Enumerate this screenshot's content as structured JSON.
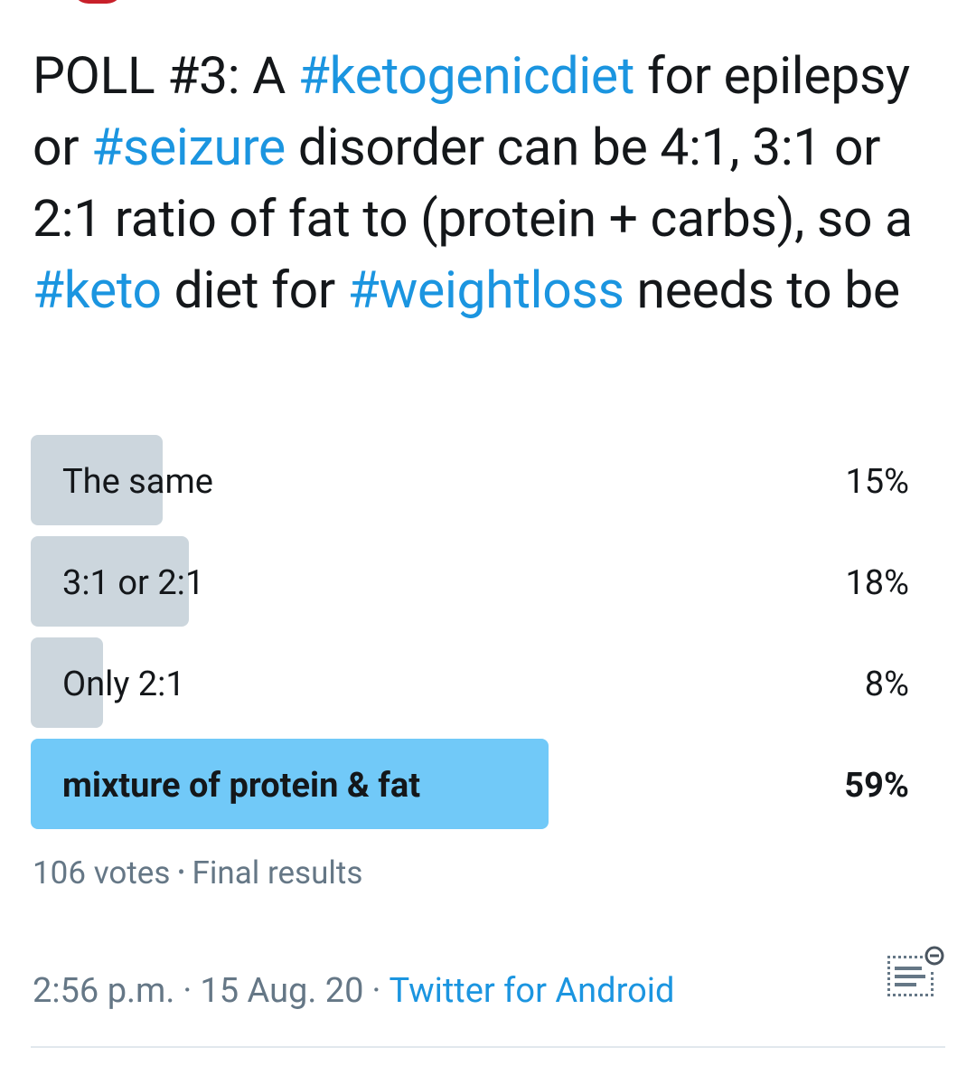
{
  "tweet": {
    "text_segments": [
      {
        "text": "POLL #3: A ",
        "hashtag": false
      },
      {
        "text": "#ketogenicdiet",
        "hashtag": true
      },
      {
        "text": " for epilepsy or ",
        "hashtag": false
      },
      {
        "text": "#seizure",
        "hashtag": true
      },
      {
        "text": " disorder can be 4:1, 3:1 or 2:1 ratio of fat to (protein + carbs), so a ",
        "hashtag": false
      },
      {
        "text": "#keto",
        "hashtag": true
      },
      {
        "text": " diet for ",
        "hashtag": false
      },
      {
        "text": "#weightloss",
        "hashtag": true
      },
      {
        "text": " needs to be",
        "hashtag": false
      }
    ]
  },
  "poll": {
    "options": [
      {
        "label": "The same",
        "percent_text": "15%",
        "percent": 15,
        "winner": false
      },
      {
        "label": "3:1 or 2:1",
        "percent_text": "18%",
        "percent": 18,
        "winner": false
      },
      {
        "label": "Only 2:1",
        "percent_text": "8%",
        "percent": 8,
        "winner": false
      },
      {
        "label": "mixture of protein & fat",
        "percent_text": "59%",
        "percent": 59,
        "winner": true
      }
    ],
    "votes": "106 votes",
    "separator": "•",
    "status": "Final results"
  },
  "meta": {
    "time": "2:56 p.m.",
    "separator": "·",
    "date": "15 Aug. 20",
    "source": "Twitter for Android"
  },
  "icons": {
    "menu": "tweet-menu-icon"
  },
  "colors": {
    "hashtag": "#1b95e0",
    "bar": "#ccd6dd",
    "winner_bar": "#71c9f8",
    "muted_text": "#657786"
  }
}
